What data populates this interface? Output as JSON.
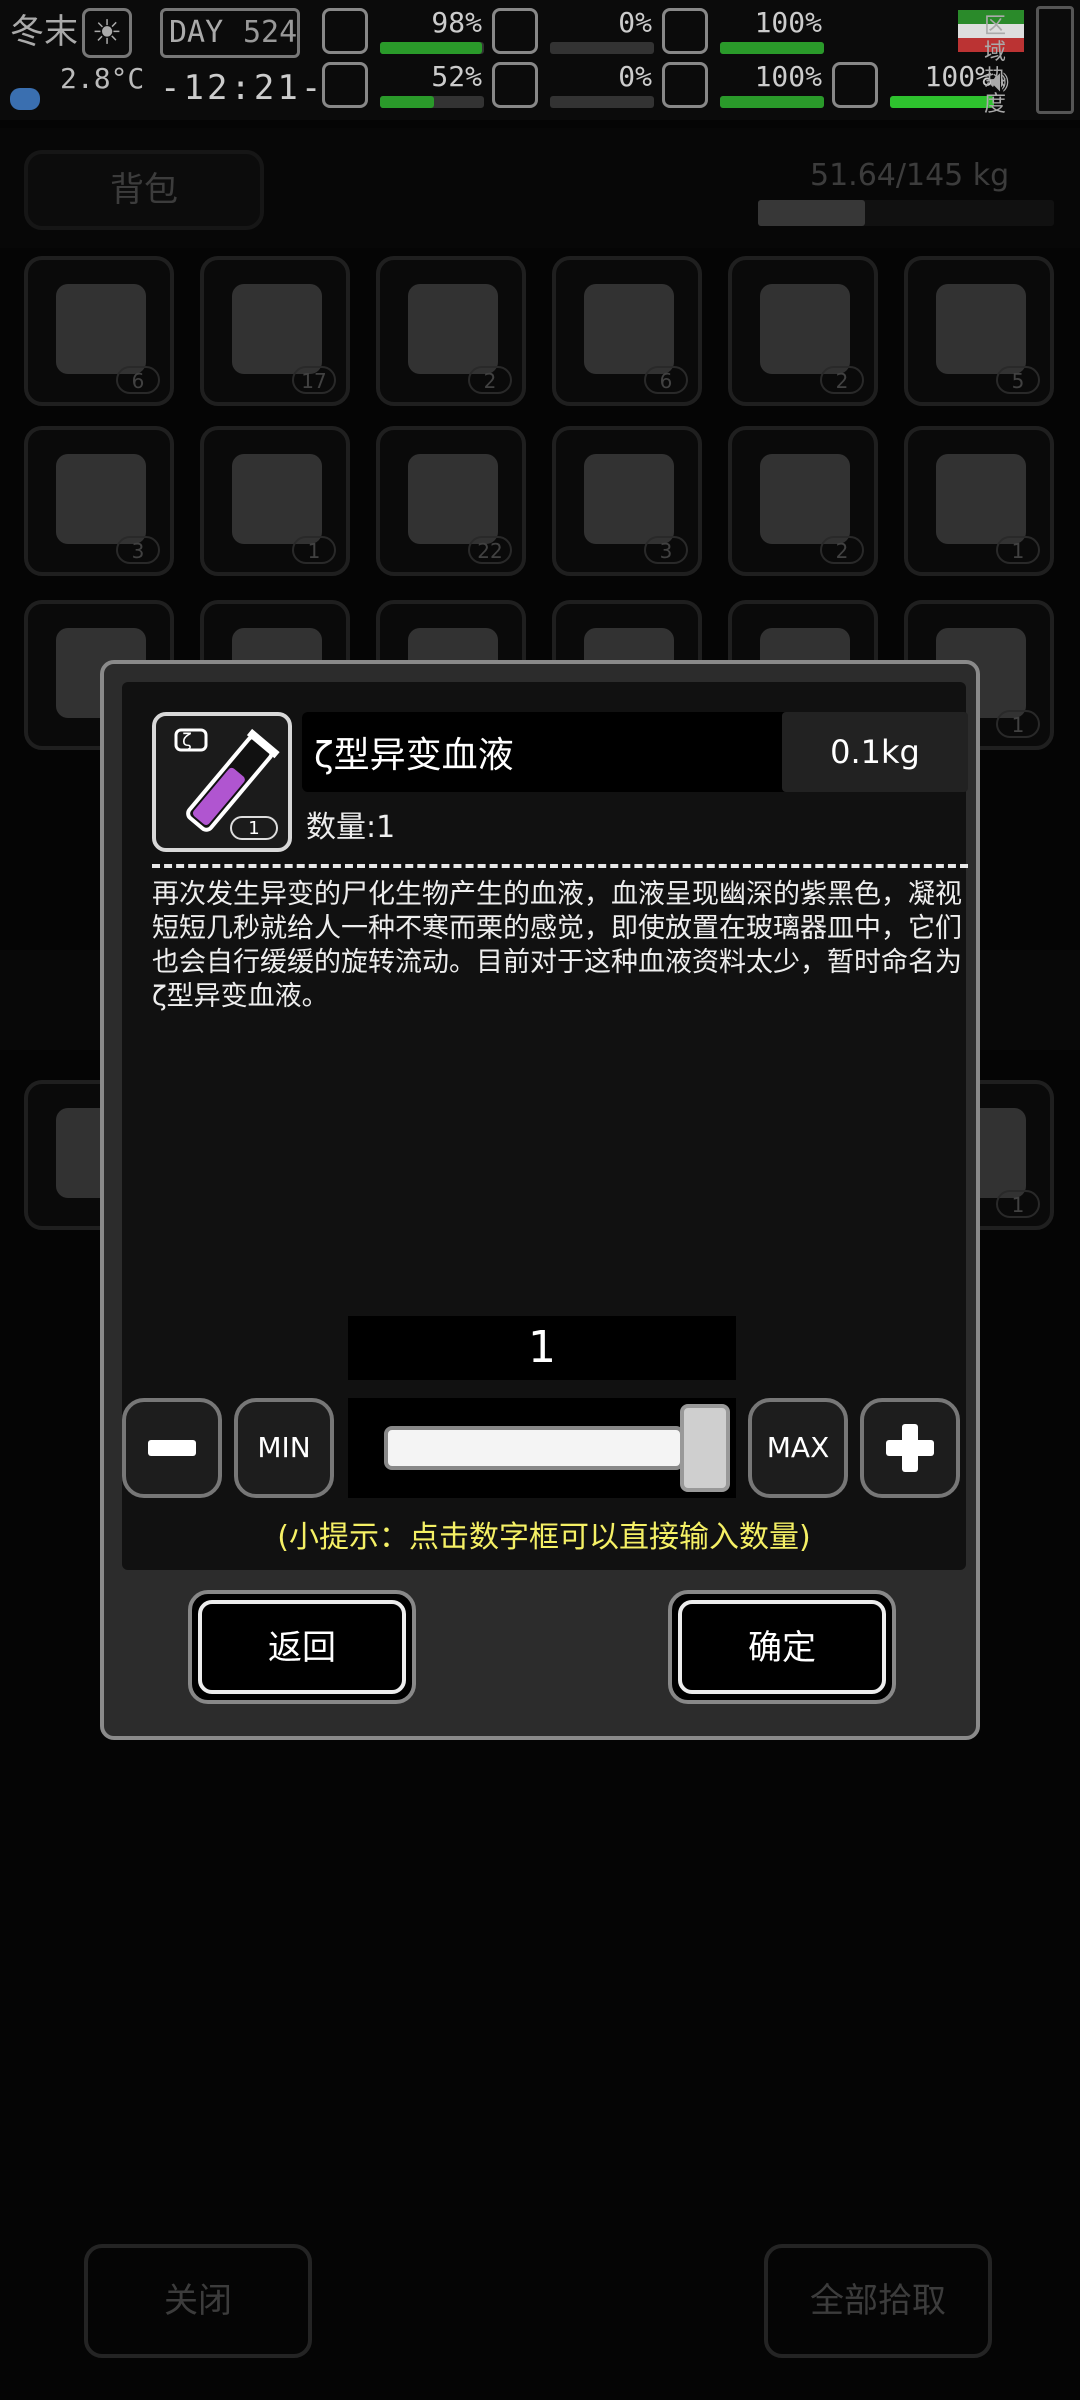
{
  "hud": {
    "season": "冬末",
    "day_label": "DAY",
    "day_number": "524",
    "temperature": "2.8°C",
    "clock": "-12:21-",
    "stats": [
      {
        "icon": "medkit-icon",
        "value": "98%",
        "level": 0.98,
        "color": "#2a9a2a"
      },
      {
        "icon": "stomach-icon",
        "value": "0%",
        "level": 0.0,
        "color": "#b33"
      },
      {
        "icon": "head-icon",
        "value": "100%",
        "level": 1.0,
        "color": "#2a9a2a"
      },
      {
        "icon": "brain-icon",
        "value": "52%",
        "level": 0.52,
        "color": "#2a9a2a"
      },
      {
        "icon": "blood-drop-icon",
        "value": "0%",
        "level": 0.0,
        "color": "#b33"
      },
      {
        "icon": "heart-icon",
        "value": "100%",
        "level": 1.0,
        "color": "#2a9a2a"
      },
      {
        "icon": "runner-icon",
        "value": "100%",
        "level": 1.0,
        "color": "#2ec22e"
      }
    ],
    "region_heat_label": "区域热度"
  },
  "bag": {
    "title": "背包",
    "weight": "51.64/145 kg",
    "weight_level": 0.36,
    "row1_counts": [
      "6",
      "17",
      "2",
      "6",
      "2",
      "5"
    ],
    "row2_counts": [
      "3",
      "1",
      "22",
      "3",
      "2",
      "1"
    ],
    "row3_counts": [
      "",
      "",
      "",
      "",
      "",
      "1"
    ],
    "row4_counts": [
      "",
      "",
      "",
      "",
      "",
      "1"
    ]
  },
  "bottom": {
    "close_label": "关闭",
    "pickup_all_label": "全部拾取"
  },
  "dialog": {
    "item_name": "ζ型异变血液",
    "item_weight": "0.1kg",
    "item_icon_badge": "ζ",
    "item_count_badge": "1",
    "quantity_label": "数量:1",
    "description": "再次发生异变的尸化生物产生的血液，血液呈现幽深的紫黑色，凝视短短几秒就给人一种不寒而栗的感觉，即使放置在玻璃器皿中，它们也会自行缓缓的旋转流动。目前对于这种血液资料太少，暂时命名为ζ型异变血液。",
    "quantity_value": "1",
    "slider_level": 1.0,
    "min_label": "MIN",
    "max_label": "MAX",
    "tip": "(小提示：点击数字框可以直接输入数量)",
    "back_label": "返回",
    "confirm_label": "确定"
  }
}
